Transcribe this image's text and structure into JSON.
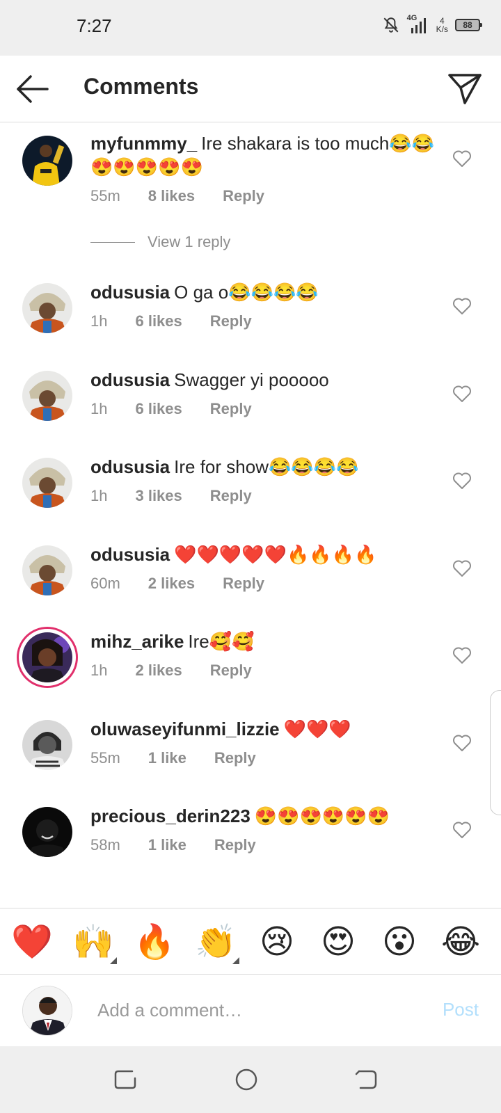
{
  "status_bar": {
    "time": "7:27",
    "network": "4G",
    "speed_value": "4",
    "speed_unit": "K/s",
    "battery": "88"
  },
  "header": {
    "title": "Comments",
    "back_icon": "arrow-left-icon",
    "send_icon": "paper-plane-icon"
  },
  "comments": [
    {
      "username": "myfunmmy_",
      "text": "Ire shakara is too much😂😂😍😍😍😍😍",
      "time": "55m",
      "likes": "8 likes",
      "reply": "Reply",
      "view_replies": "View 1 reply"
    },
    {
      "username": "odususia",
      "text": "O ga o😂😂😂😂",
      "time": "1h",
      "likes": "6 likes",
      "reply": "Reply"
    },
    {
      "username": "odususia",
      "text": "Swagger yi pooooo",
      "time": "1h",
      "likes": "6 likes",
      "reply": "Reply"
    },
    {
      "username": "odususia",
      "text": "Ire for show😂😂😂😂",
      "time": "1h",
      "likes": "3 likes",
      "reply": "Reply"
    },
    {
      "username": "odususia",
      "text": "❤️❤️❤️❤️❤️🔥🔥🔥🔥",
      "time": "60m",
      "likes": "2 likes",
      "reply": "Reply"
    },
    {
      "username": "mihz_arike",
      "text": "Ire🥰🥰",
      "time": "1h",
      "likes": "2 likes",
      "reply": "Reply"
    },
    {
      "username": "oluwaseyifunmi_lizzie",
      "text": "❤️❤️❤️",
      "time": "55m",
      "likes": "1 like",
      "reply": "Reply"
    },
    {
      "username": "precious_derin223",
      "text": "😍😍😍😍😍😍",
      "time": "58m",
      "likes": "1 like",
      "reply": "Reply"
    }
  ],
  "quick_emojis": [
    "❤️",
    "🙌",
    "🔥",
    "👏",
    "😢",
    "😍",
    "😮",
    "😂"
  ],
  "composer": {
    "placeholder": "Add a comment…",
    "post_label": "Post"
  },
  "colors": {
    "accent_blue_disabled": "#b2dffc",
    "meta_gray": "#8e8e8e",
    "story_ring": "#e1306c"
  }
}
